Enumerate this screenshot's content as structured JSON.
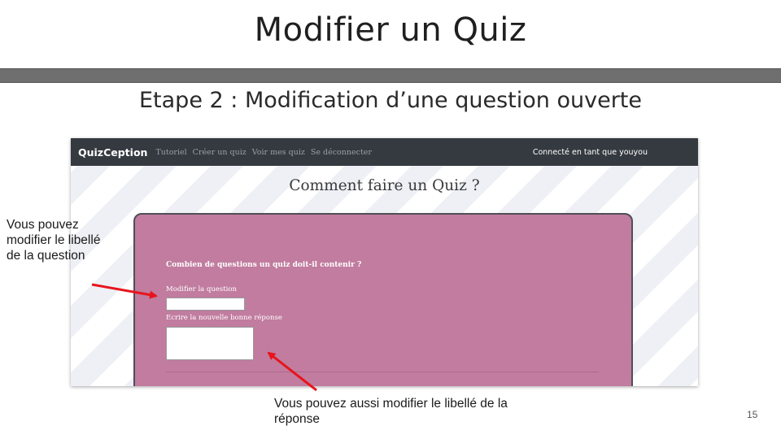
{
  "slide": {
    "title": "Modifier un Quiz",
    "subtitle": "Etape 2 : Modification d’une question ouverte",
    "page_number": "15"
  },
  "app": {
    "brand": "QuizCeption",
    "nav": [
      "Tutoriel",
      "Créer un quiz",
      "Voir mes quiz",
      "Se déconnecter"
    ],
    "user_status": "Connecté en tant que youyou",
    "heading": "Comment faire un Quiz ?",
    "form": {
      "question_text": "Combien de questions un quiz doit-il contenir ?",
      "modify_question_label": "Modifier la question",
      "question_input_value": "",
      "answer_label": "Ecrire la nouvelle bonne réponse",
      "answer_textarea_value": ""
    }
  },
  "annotations": {
    "left": "Vous pouvez modifier le libellé de la question",
    "bottom": "Vous pouvez aussi modifier le libellé de la réponse"
  },
  "colors": {
    "navbar": "#353a40",
    "card": "#c17c9f",
    "title_bar": "#6f6f6f",
    "arrow": "#e8141c"
  }
}
